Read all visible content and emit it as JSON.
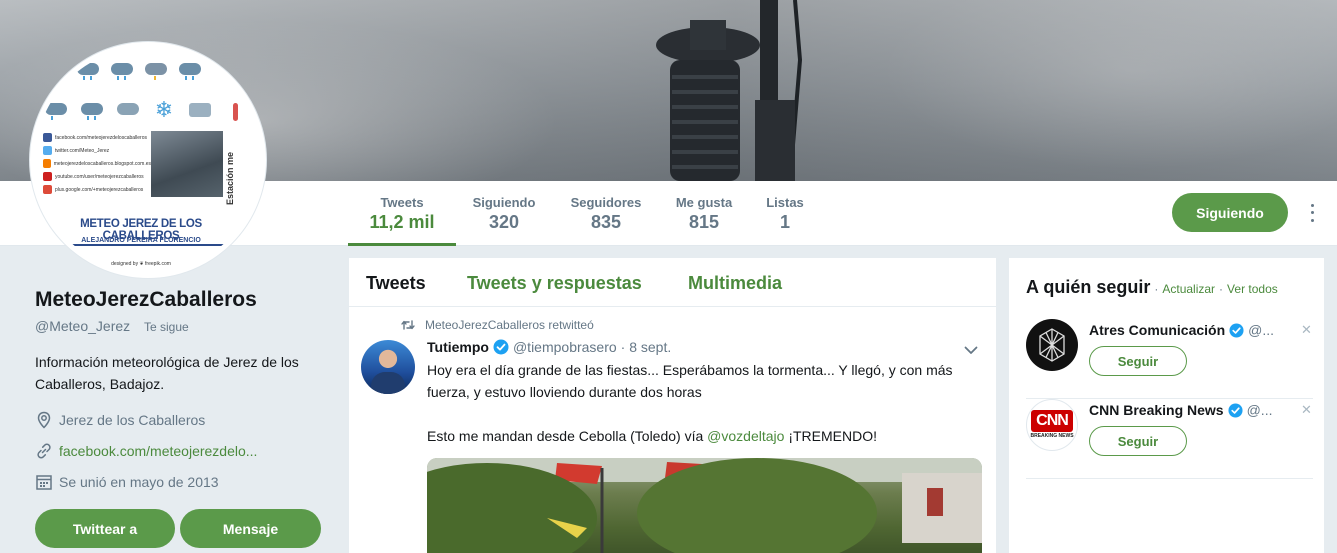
{
  "profile": {
    "name": "MeteoJerezCaballeros",
    "handle": "@Meteo_Jerez",
    "follows_you": "Te sigue",
    "bio": "Información meteorológica de Jerez de los Caballeros, Badajoz.",
    "location": "Jerez de los Caballeros",
    "url": "facebook.com/meteojerezdelo...",
    "joined": "Se unió en mayo de 2013",
    "tweet_button": "Twittear a",
    "message_button": "Mensaje",
    "avatar": {
      "title": "METEO JEREZ DE LOS CABALLEROS",
      "subtitle": "ALEJANDRO PEREIRA FLORENCIO",
      "side_text": "Estación me",
      "footer": "designed by ❦ freepik.com",
      "social": [
        "facebook.com/meteojerezdeloscaballeros",
        "twitter.com/Meteo_Jerez",
        "meteojerezdeloscaballeros.blogspot.com.es",
        "youtube.com/user/meteojerezcaballeros",
        "plus.google.com/+meteojerezcaballeros"
      ],
      "social_colors": [
        "#3b5998",
        "#55acee",
        "#f57d00",
        "#cd201f",
        "#dd4b39"
      ]
    }
  },
  "stats": [
    {
      "label": "Tweets",
      "value": "11,2 mil"
    },
    {
      "label": "Siguiendo",
      "value": "320"
    },
    {
      "label": "Seguidores",
      "value": "835"
    },
    {
      "label": "Me gusta",
      "value": "815"
    },
    {
      "label": "Listas",
      "value": "1"
    }
  ],
  "follow_button": "Siguiendo",
  "timeline": {
    "tabs": [
      "Tweets",
      "Tweets y respuestas",
      "Multimedia"
    ],
    "retweet_context": "MeteoJerezCaballeros retwitteó",
    "tweet": {
      "author": "Tutiempo",
      "handle": "@tiempobrasero",
      "date": "· 8 sept.",
      "line1": "Hoy era el día grande de las fiestas... Esperábamos la tormenta... Y llegó, y con más fuerza, y estuvo lloviendo durante dos horas",
      "line2_pre": "Esto me mandan desde Cebolla (Toledo) vía ",
      "mention": "@vozdeltajo",
      "line2_post": " ¡TREMENDO!"
    }
  },
  "who_to_follow": {
    "title": "A quién seguir",
    "sep": "·",
    "refresh": "Actualizar",
    "view_all": "Ver todos",
    "accounts": [
      {
        "name": "Atres Comunicación",
        "handle": "@...",
        "button": "Seguir",
        "close": "✕"
      },
      {
        "name": "CNN Breaking News",
        "handle": "@...",
        "button": "Seguir",
        "close": "✕",
        "logo": "CNN",
        "logo_sub": "BREAKING NEWS"
      }
    ]
  },
  "colors": {
    "accent": "#5b9a4a",
    "link": "#4b8a3d",
    "background": "#e6ecf0"
  }
}
